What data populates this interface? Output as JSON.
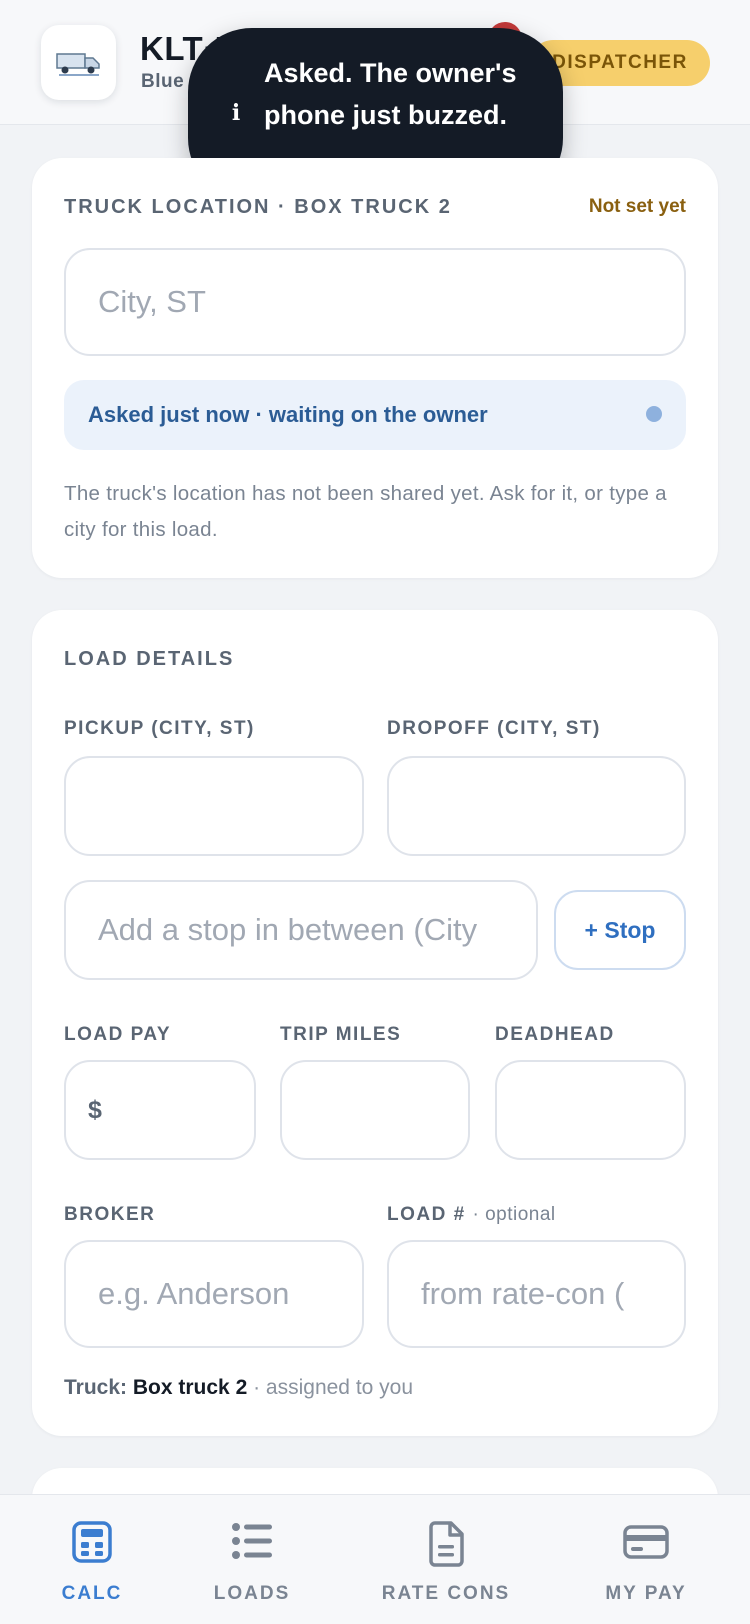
{
  "header": {
    "title": "KLT·P",
    "subtitle": "Blue",
    "role_badge": "DISPATCHER"
  },
  "toast": {
    "icon": "info-icon",
    "message": "Asked. The owner's phone just buzzed."
  },
  "truck_location": {
    "section_label": "TRUCK LOCATION · BOX TRUCK 2",
    "status": "Not set yet",
    "input_placeholder": "City, ST",
    "input_value": "",
    "banner_text": "Asked just now · waiting on the owner",
    "help_text": "The truck's location has not been shared yet. Ask for it, or type a city for this load."
  },
  "load_details": {
    "section_label": "LOAD DETAILS",
    "pickup_label": "PICKUP (CITY, ST)",
    "pickup_value": "",
    "dropoff_label": "DROPOFF (CITY, ST)",
    "dropoff_value": "",
    "stop_placeholder": "Add a stop in between (City",
    "stop_button": "+ Stop",
    "load_pay_label": "LOAD PAY",
    "currency_symbol": "$",
    "load_pay_value": "",
    "trip_miles_label": "TRIP MILES",
    "trip_miles_value": "",
    "deadhead_label": "DEADHEAD",
    "deadhead_value": "",
    "broker_label": "BROKER",
    "broker_placeholder": "e.g. Anderson",
    "load_number_label": "LOAD #",
    "load_number_optional": "· optional",
    "load_number_placeholder": "from rate-con (",
    "truck_prefix": "Truck:",
    "truck_name": "Box truck 2",
    "truck_note": "· assigned to you"
  },
  "bottom_nav": {
    "items": [
      {
        "label": "CALC",
        "icon": "calculator-icon",
        "active": true
      },
      {
        "label": "LOADS",
        "icon": "list-icon",
        "active": false
      },
      {
        "label": "RATE CONS",
        "icon": "document-icon",
        "active": false
      },
      {
        "label": "MY PAY",
        "icon": "credit-card-icon",
        "active": false
      }
    ]
  },
  "colors": {
    "accent": "#3b7dd0",
    "role_badge_bg": "#f6cf6c",
    "toast_bg": "#141b26",
    "notification": "#c33a3a",
    "banner_bg": "#ebf2fb"
  }
}
